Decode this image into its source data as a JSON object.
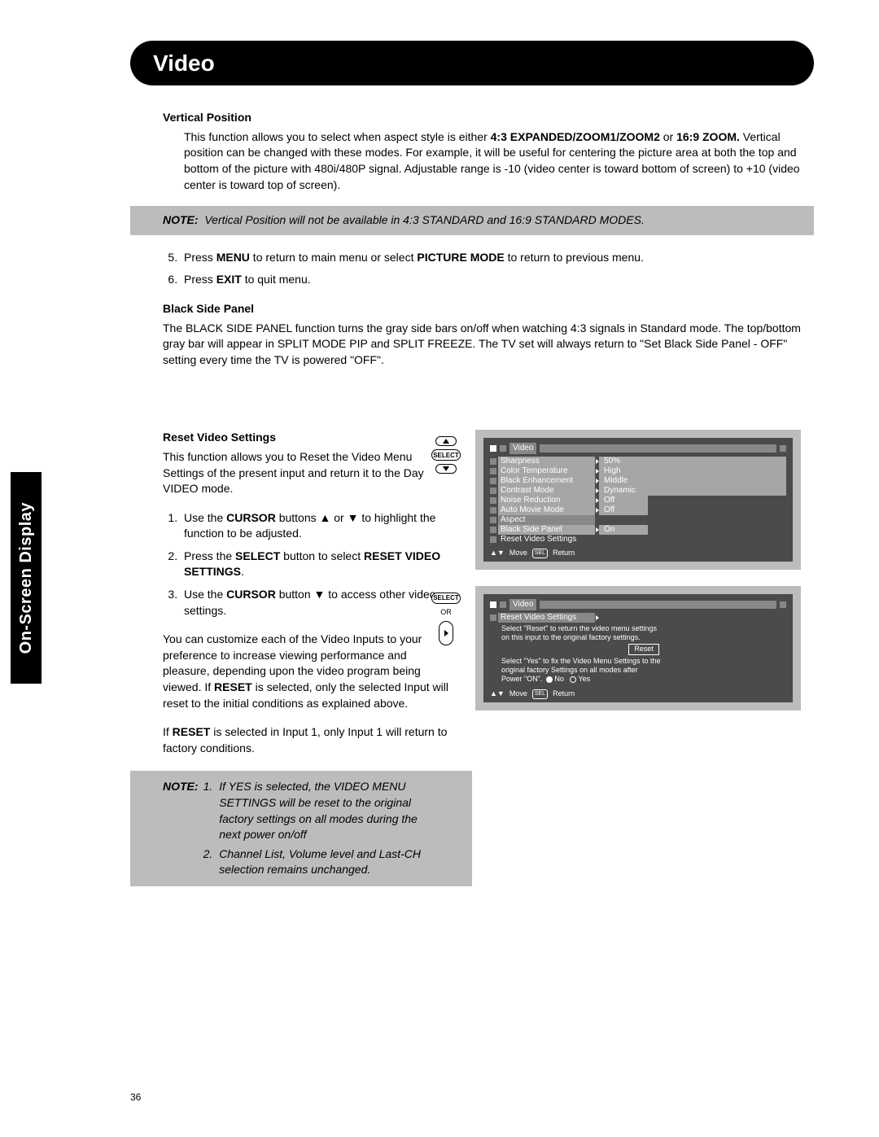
{
  "side_tab": "On-Screen Display",
  "title": "Video",
  "page_number": "36",
  "sec1": {
    "heading": "Vertical Position",
    "para_a": "This function allows you to select when aspect style is either ",
    "para_b": "4:3 EXPANDED/ZOOM1/ZOOM2",
    "para_c": " or ",
    "para_d": "16:9 ZOOM.",
    "para_e": " Vertical position can be changed with these modes. For example, it will be useful for centering the picture area at both the top and bottom of the picture with 480i/480P signal. Adjustable range is -10 (video center is toward bottom of screen) to +10 (video center is toward top of screen)."
  },
  "note1": {
    "prefix": "NOTE:",
    "body": "Vertical Position will not be available in 4:3 STANDARD and 16:9 STANDARD MODES."
  },
  "steps56": {
    "s5_a": "Press ",
    "s5_b": "MENU",
    "s5_c": " to return to main menu or select ",
    "s5_d": "PICTURE MODE",
    "s5_e": " to return to previous menu.",
    "s6_a": "Press ",
    "s6_b": "EXIT",
    "s6_c": " to quit menu."
  },
  "sec2": {
    "heading": "Black Side Panel",
    "body": "The BLACK SIDE PANEL function turns the gray side bars on/off when watching 4:3 signals in Standard mode. The top/bottom gray bar will appear in SPLIT MODE PIP and SPLIT FREEZE. The TV set will always return to \"Set Black Side Panel - OFF\" setting every time the TV is powered \"OFF\"."
  },
  "sec3": {
    "heading": "Reset Video Settings",
    "intro": "This function allows you to Reset the Video Menu Settings of the present input and return it to the Day VIDEO mode.",
    "s1_a": "Use the ",
    "s1_b": "CURSOR",
    "s1_c": " buttons ▲ or ▼ to highlight the function to be adjusted.",
    "s2_a": "Press the ",
    "s2_b": "SELECT",
    "s2_c": " button to select ",
    "s2_d": "RESET VIDEO SETTINGS",
    "s2_e": ".",
    "s3_a": "Use the ",
    "s3_b": "CURSOR",
    "s3_c": " button ▼ to access other video settings.",
    "p4_a": "You can customize each of the Video Inputs to your preference to increase viewing performance and pleasure, depending upon the video program being viewed. If ",
    "p4_b": "RESET",
    "p4_c": " is selected, only the selected Input will reset to the initial conditions as explained above.",
    "p5_a": "If ",
    "p5_b": "RESET",
    "p5_c": " is selected in Input 1, only Input 1 will return to factory conditions."
  },
  "note2": {
    "prefix": "NOTE:",
    "n1a": "1.",
    "n1b": "If YES is selected, the VIDEO MENU SETTINGS will be reset to the original factory settings on all modes during the next power on/off",
    "n2a": "2.",
    "n2b": "Channel List, Volume level and Last-CH selection remains unchanged."
  },
  "osd1": {
    "select_btn": "SELECT",
    "title": "Video",
    "items": [
      {
        "label": "Sharpness",
        "value": "50%"
      },
      {
        "label": "Color Temperature",
        "value": "High"
      },
      {
        "label": "Black Enhancement",
        "value": "Middle"
      },
      {
        "label": "Contrast Mode",
        "value": "Dynamic"
      },
      {
        "label": "Noise Reduction",
        "value": "Off"
      },
      {
        "label": "Auto Movie Mode",
        "value": "Off"
      },
      {
        "label": "Aspect",
        "value": ""
      },
      {
        "label": "Black Side Panel",
        "value": "On"
      },
      {
        "label": "Reset Video Settings",
        "value": ""
      }
    ],
    "move": "Move",
    "sel": "SEL",
    "return": "Return"
  },
  "osd2": {
    "select_btn": "SELECT",
    "or": "OR",
    "title": "Video",
    "subtitle": "Reset Video Settings",
    "line1": "Select \"Reset\" to return the video menu settings",
    "line2": "on this input to the original factory settings.",
    "reset": "Reset",
    "line3": "Select \"Yes\" to fix the Video Menu Settings to the",
    "line4": "original factory Settings on all modes after",
    "line5": "Power \"ON\".",
    "no": "No",
    "yes": "Yes",
    "move": "Move",
    "sel": "SEL",
    "return": "Return"
  }
}
